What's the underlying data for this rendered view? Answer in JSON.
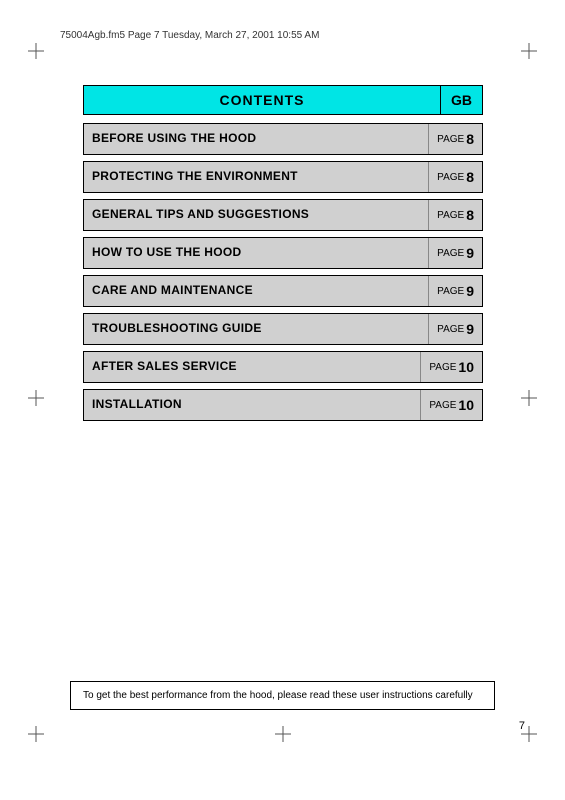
{
  "fileInfo": {
    "text": "75004Agb.fm5  Page 7  Tuesday, March 27, 2001  10:55 AM"
  },
  "header": {
    "title": "CONTENTS",
    "badge": "GB"
  },
  "tocItems": [
    {
      "label": "BEFORE USING THE HOOD",
      "pageWord": "PAGE",
      "pageNum": "8"
    },
    {
      "label": "PROTECTING THE ENVIRONMENT",
      "pageWord": "PAGE",
      "pageNum": "8"
    },
    {
      "label": "GENERAL TIPS AND SUGGESTIONS",
      "pageWord": "PAGE",
      "pageNum": "8"
    },
    {
      "label": "HOW TO USE THE HOOD",
      "pageWord": "PAGE",
      "pageNum": "9"
    },
    {
      "label": "CARE AND MAINTENANCE",
      "pageWord": "PAGE",
      "pageNum": "9"
    },
    {
      "label": "TROUBLESHOOTING GUIDE",
      "pageWord": "PAGE",
      "pageNum": "9"
    },
    {
      "label": "AFTER SALES SERVICE",
      "pageWord": "PAGE",
      "pageNum": "10"
    },
    {
      "label": "INSTALLATION",
      "pageWord": "PAGE",
      "pageNum": "10"
    }
  ],
  "bottomNote": "To get the best performance from the hood, please read these user instructions carefully",
  "pageNumber": "7"
}
